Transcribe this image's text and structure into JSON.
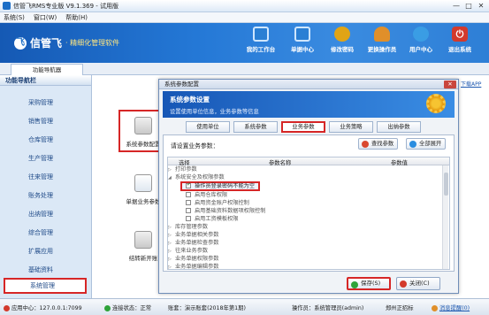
{
  "window": {
    "title": "信管飞RMS专业版 V9.1.369 - 试用版",
    "min": "—",
    "max": "□",
    "close": "✕"
  },
  "menu": [
    "系统(S)",
    "窗口(W)",
    "帮助(H)"
  ],
  "brand": {
    "logo_text": "飞",
    "name": "信管飞",
    "subtitle": "· 精细化管理软件"
  },
  "toolbar": [
    {
      "label": "我的工作台",
      "icon": "monitor-icon",
      "color": "#2a7fd4"
    },
    {
      "label": "单据中心",
      "icon": "monitor-icon",
      "color": "#2a7fd4"
    },
    {
      "label": "修改密码",
      "icon": "key-icon",
      "color": "#e0a415"
    },
    {
      "label": "更换操作员",
      "icon": "user-icon",
      "color": "#e08f2a"
    },
    {
      "label": "用户中心",
      "icon": "users-icon",
      "color": "#3a9de4"
    },
    {
      "label": "退出系统",
      "icon": "power-icon",
      "color": "#d33a2c"
    }
  ],
  "tab_nav": "功能导航器",
  "sidebar": {
    "header": "功能导航栏",
    "items": [
      "采购管理",
      "销售管理",
      "仓库管理",
      "生产管理",
      "往来管理",
      "账务处理",
      "出纳管理",
      "综合管理",
      "扩展应用",
      "基础资料",
      "系统管理"
    ],
    "active": "系统管理"
  },
  "modules": [
    {
      "label": "系统参数配置",
      "icon": "database-gear-icon"
    },
    {
      "label": "单据业务参数",
      "icon": "document-gear-icon"
    },
    {
      "label": "结转新开账",
      "icon": "database-refresh-icon"
    }
  ],
  "side_link": "下载APP",
  "dialog": {
    "title": "系统参数配置",
    "close": "✕",
    "header_title": "系统参数设置",
    "header_subtitle": "设置使用单位信息，业务参数等信息",
    "tabs": [
      "使用单位",
      "系统参数",
      "业务参数",
      "业务策略",
      "出纳参数"
    ],
    "active_tab": "业务参数",
    "prompt": "请设置业务参数：",
    "search_button": "查找参数",
    "expand_button": "全部展开",
    "columns": [
      "选择",
      "参数名称",
      "参数值"
    ],
    "rows": [
      {
        "type": "group",
        "label": "打印参数",
        "expanded": false
      },
      {
        "type": "group",
        "label": "系统安全及权限参数",
        "expanded": true
      },
      {
        "type": "param",
        "label": "操作员登录密码不能为空",
        "checked": true,
        "highlight": true
      },
      {
        "type": "param",
        "label": "启用仓库权限",
        "checked": false
      },
      {
        "type": "param",
        "label": "启用资金账户权限控制",
        "checked": false
      },
      {
        "type": "param",
        "label": "启用基础资料数据项权限控制",
        "checked": false
      },
      {
        "type": "param",
        "label": "启用工资模板权限",
        "checked": false
      },
      {
        "type": "group",
        "label": "库存管理参数",
        "expanded": false
      },
      {
        "type": "group",
        "label": "业务单据相关参数",
        "expanded": false
      },
      {
        "type": "group",
        "label": "业务单据检查参数",
        "expanded": false
      },
      {
        "type": "group",
        "label": "往来业务参数",
        "expanded": false
      },
      {
        "type": "group",
        "label": "业务单据权限参数",
        "expanded": false
      },
      {
        "type": "group",
        "label": "业务单据编辑参数",
        "expanded": false
      }
    ],
    "save_button": "保存(S)",
    "close_button": "关闭(C)"
  },
  "status": {
    "app_center": "应用中心：127.0.0.1:7099",
    "connection": "连接状态：正常",
    "account": "账套：演示账套(2018年第1期)",
    "operator": "操作员：系统管理员(admin)",
    "company": "郑州正招标",
    "messages": "消息提醒(0)"
  }
}
